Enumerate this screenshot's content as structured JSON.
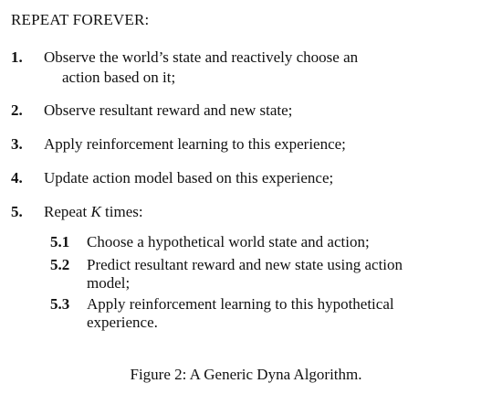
{
  "header": "REPEAT FOREVER:",
  "steps": [
    {
      "num": "1.",
      "line1": "Observe the world’s state and reactively choose an",
      "line2": "action based on it;"
    },
    {
      "num": "2.",
      "line1": "Observe resultant reward and new state;"
    },
    {
      "num": "3.",
      "line1": "Apply reinforcement learning to this experience;"
    },
    {
      "num": "4.",
      "line1": "Update action model based on this experience;"
    },
    {
      "num": "5.",
      "pre": "Repeat ",
      "var": "K",
      "post": " times:"
    }
  ],
  "substeps": [
    {
      "num": "5.1",
      "line1": "Choose a hypothetical world state and action;"
    },
    {
      "num": "5.2",
      "line1": "Predict resultant reward and new state using action",
      "line2": "model;"
    },
    {
      "num": "5.3",
      "line1": "Apply reinforcement learning to this hypothetical",
      "line2": "experience."
    }
  ],
  "caption": "Figure 2: A Generic Dyna Algorithm."
}
